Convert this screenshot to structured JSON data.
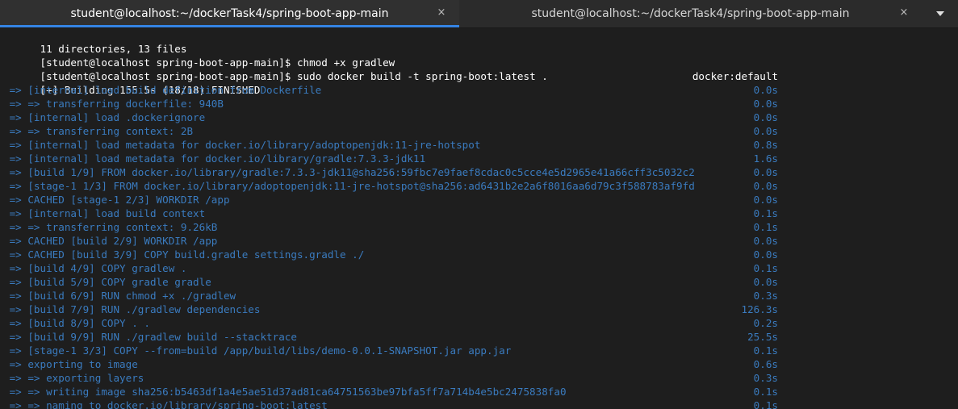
{
  "tabs": [
    {
      "title": "student@localhost:~/dockerTask4/spring-boot-app-main",
      "close": "×",
      "active": true
    },
    {
      "title": "student@localhost:~/dockerTask4/spring-boot-app-main",
      "close": "×",
      "active": false
    }
  ],
  "menu_icon": "chevron-down-icon",
  "terminal": {
    "plain_lines": [
      "11 directories, 13 files"
    ],
    "prompts": [
      {
        "prompt": "[student@localhost spring-boot-app-main]$ ",
        "command": "chmod +x gradlew"
      },
      {
        "prompt": "[student@localhost spring-boot-app-main]$ ",
        "command": "sudo docker build -t spring-boot:latest ."
      }
    ],
    "build_header": {
      "text": "[+] Building 155.5s (18/18) FINISHED",
      "right": "docker:default"
    },
    "build_steps": [
      {
        "text": " => [internal] load build definition from Dockerfile",
        "time": "0.0s"
      },
      {
        "text": " => => transferring dockerfile: 940B",
        "time": "0.0s"
      },
      {
        "text": " => [internal] load .dockerignore",
        "time": "0.0s"
      },
      {
        "text": " => => transferring context: 2B",
        "time": "0.0s"
      },
      {
        "text": " => [internal] load metadata for docker.io/library/adoptopenjdk:11-jre-hotspot",
        "time": "0.8s"
      },
      {
        "text": " => [internal] load metadata for docker.io/library/gradle:7.3.3-jdk11",
        "time": "1.6s"
      },
      {
        "text": " => [build 1/9] FROM docker.io/library/gradle:7.3.3-jdk11@sha256:59fbc7e9faef8cdac0c5cce4e5d2965e41a66cff3c5032c2",
        "time": "0.0s"
      },
      {
        "text": " => [stage-1 1/3] FROM docker.io/library/adoptopenjdk:11-jre-hotspot@sha256:ad6431b2e2a6f8016aa6d79c3f588783af9fd",
        "time": "0.0s"
      },
      {
        "text": " => CACHED [stage-1 2/3] WORKDIR /app",
        "time": "0.0s"
      },
      {
        "text": " => [internal] load build context",
        "time": "0.1s"
      },
      {
        "text": " => => transferring context: 9.26kB",
        "time": "0.1s"
      },
      {
        "text": " => CACHED [build 2/9] WORKDIR /app",
        "time": "0.0s"
      },
      {
        "text": " => CACHED [build 3/9] COPY build.gradle settings.gradle ./",
        "time": "0.0s"
      },
      {
        "text": " => [build 4/9] COPY gradlew .",
        "time": "0.1s"
      },
      {
        "text": " => [build 5/9] COPY gradle gradle",
        "time": "0.0s"
      },
      {
        "text": " => [build 6/9] RUN chmod +x ./gradlew",
        "time": "0.3s"
      },
      {
        "text": " => [build 7/9] RUN ./gradlew dependencies",
        "time": "126.3s"
      },
      {
        "text": " => [build 8/9] COPY . .",
        "time": "0.2s"
      },
      {
        "text": " => [build 9/9] RUN ./gradlew build --stacktrace",
        "time": "25.5s"
      },
      {
        "text": " => [stage-1 3/3] COPY --from=build /app/build/libs/demo-0.0.1-SNAPSHOT.jar app.jar",
        "time": "0.1s"
      },
      {
        "text": " => exporting to image",
        "time": "0.6s"
      },
      {
        "text": " => => exporting layers",
        "time": "0.3s"
      },
      {
        "text": " => => writing image sha256:b5463df1a4e5ae51d37ad81ca64751563be97bfa5ff7a714b4e5bc2475838fa0",
        "time": "0.1s"
      },
      {
        "text": " => => naming to docker.io/library/spring-boot:latest",
        "time": "0.1s"
      }
    ]
  },
  "colors": {
    "background": "#1e1e1e",
    "tab_active_indicator": "#3584e4",
    "build_step_text": "#3a7bbf",
    "text": "#ffffff"
  }
}
